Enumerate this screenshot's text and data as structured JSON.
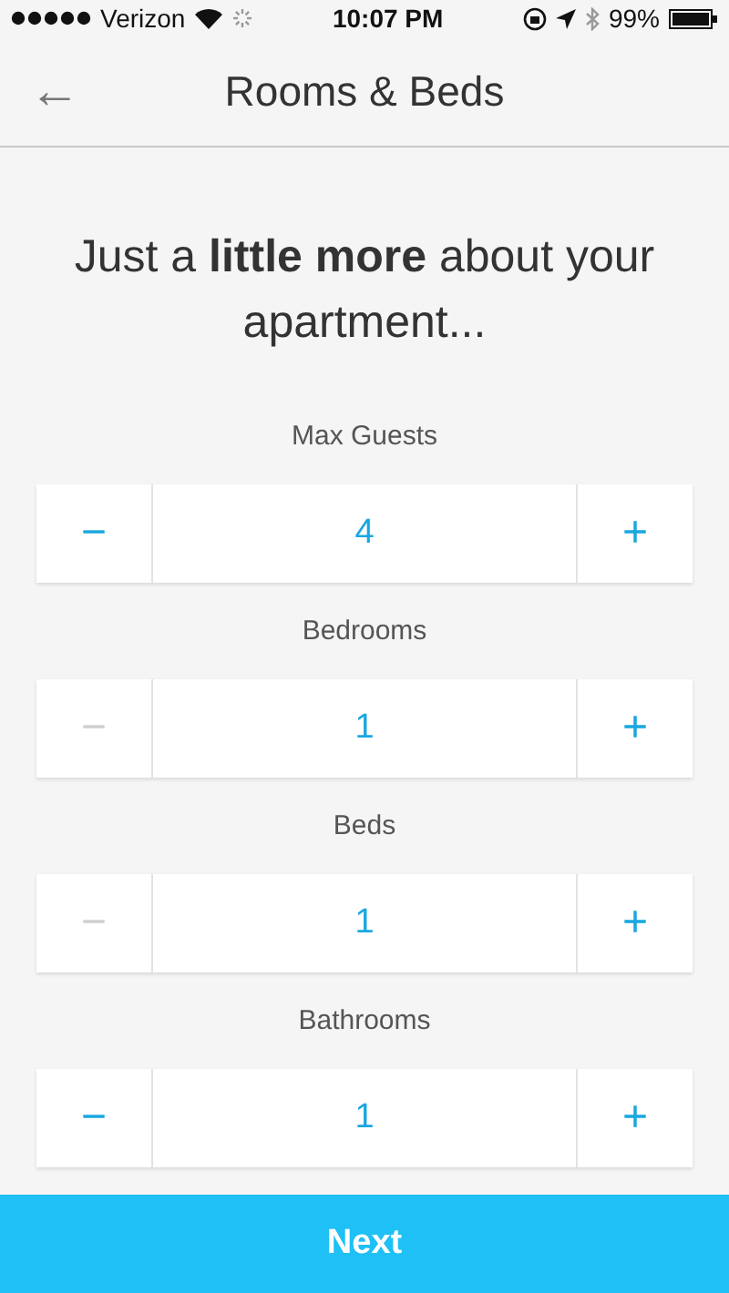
{
  "status_bar": {
    "carrier": "Verizon",
    "time": "10:07 PM",
    "battery": "99%"
  },
  "nav": {
    "back": "←",
    "title": "Rooms & Beds"
  },
  "headline": "Just a **little more** about your apartment...",
  "steppers": [
    {
      "label": "Max Guests",
      "value": "4",
      "decrement": {
        "symbol": "−",
        "disabled": false
      },
      "increment": {
        "symbol": "+",
        "disabled": false
      }
    },
    {
      "label": "Bedrooms",
      "value": "1",
      "decrement": {
        "symbol": "−",
        "disabled": true
      },
      "increment": {
        "symbol": "+",
        "disabled": false
      }
    },
    {
      "label": "Beds",
      "value": "1",
      "decrement": {
        "symbol": "−",
        "disabled": true
      },
      "increment": {
        "symbol": "+",
        "disabled": false
      }
    },
    {
      "label": "Bathrooms",
      "value": "1",
      "decrement": {
        "symbol": "−",
        "disabled": false
      },
      "increment": {
        "symbol": "+",
        "disabled": false
      }
    }
  ],
  "next_button": "Next"
}
